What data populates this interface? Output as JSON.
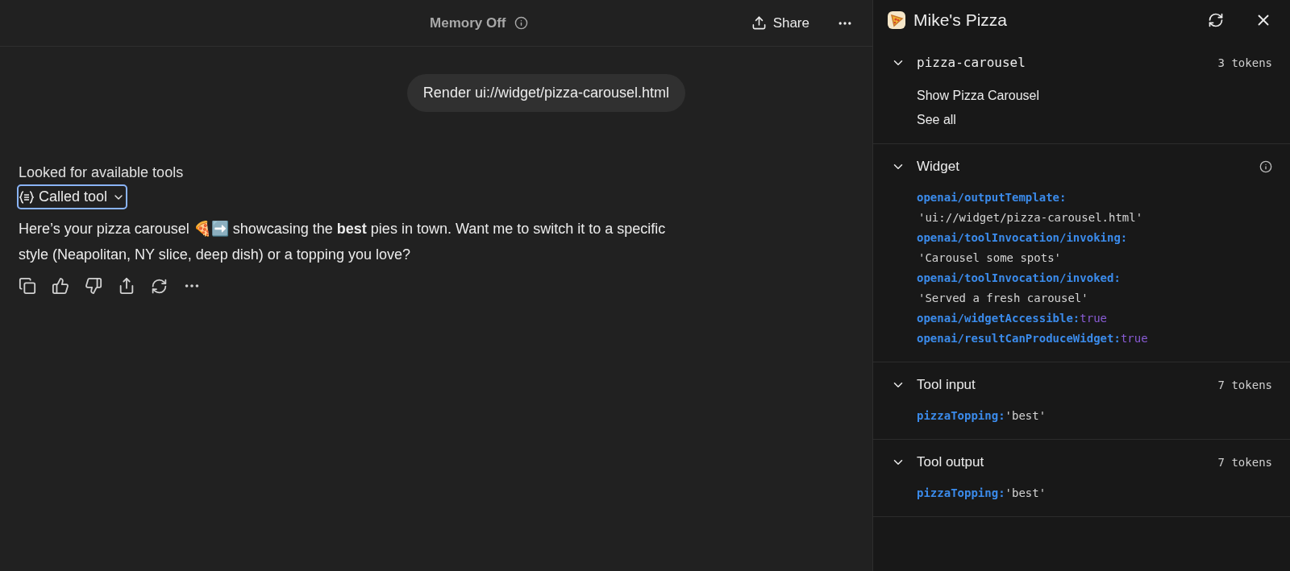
{
  "chat_header": {
    "memory_label": "Memory Off",
    "share_label": "Share"
  },
  "user_message": "Render ui://widget/pizza-carousel.html",
  "assistant": {
    "status": "Looked for available tools",
    "tool_chip": {
      "label": "Called tool",
      "focused": true
    },
    "message": "Here’s your pizza carousel 🍕➡️ showcasing the **best** pies in town. Want me to switch it to a specific style (Neapolitan, NY slice, deep dish) or a topping you love?"
  },
  "panel": {
    "title": "Mike's Pizza",
    "sections": [
      {
        "kind": "links",
        "title": "pizza-carousel",
        "tokens": "3 tokens",
        "expanded": true,
        "items": [
          "Show Pizza Carousel",
          "See all"
        ]
      },
      {
        "kind": "code",
        "title": "Widget",
        "info": true,
        "expanded": true,
        "entries": [
          {
            "key": "openai/outputTemplate:",
            "value": "'ui://widget/pizza-carousel.html'",
            "wrapped": true,
            "keyword": false
          },
          {
            "key": "openai/toolInvocation/invoking:",
            "value": "'Carousel some spots'",
            "wrapped": true,
            "keyword": false
          },
          {
            "key": "openai/toolInvocation/invoked:",
            "value": "'Served a fresh carousel'",
            "wrapped": true,
            "keyword": false
          },
          {
            "key": "openai/widgetAccessible:",
            "value": "true",
            "wrapped": false,
            "keyword": true
          },
          {
            "key": "openai/resultCanProduceWidget:",
            "value": "true",
            "wrapped": false,
            "keyword": true
          }
        ]
      },
      {
        "kind": "code",
        "title": "Tool input",
        "tokens": "7 tokens",
        "expanded": true,
        "entries": [
          {
            "key": "pizzaTopping:",
            "value": "'best'",
            "wrapped": false,
            "keyword": false
          }
        ]
      },
      {
        "kind": "code",
        "title": "Tool output",
        "tokens": "7 tokens",
        "expanded": true,
        "entries": [
          {
            "key": "pizzaTopping:",
            "value": "'best'",
            "wrapped": false,
            "keyword": false
          }
        ]
      }
    ]
  }
}
